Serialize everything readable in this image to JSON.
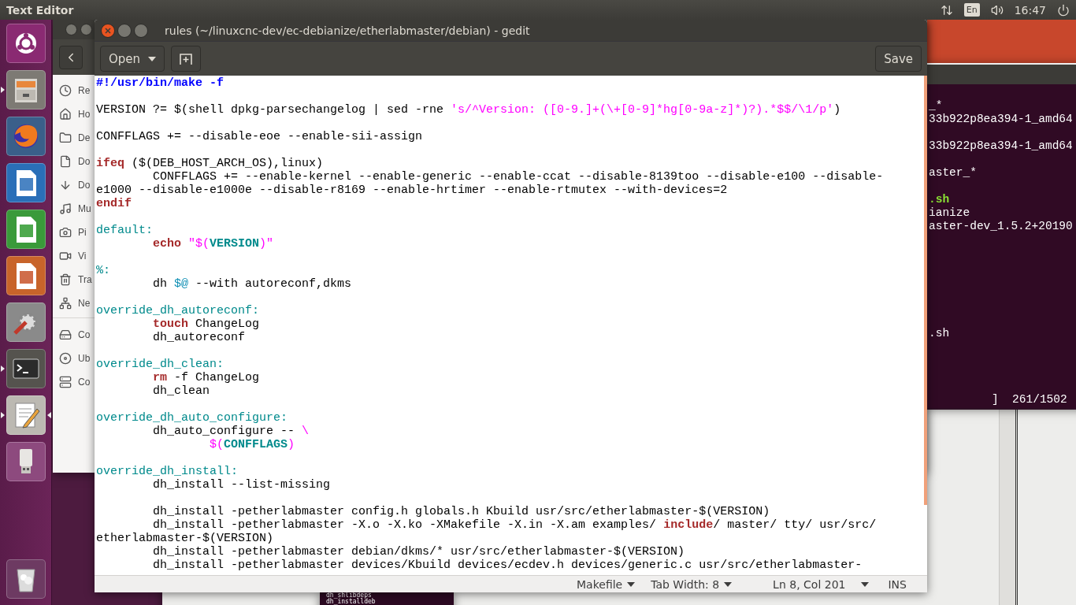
{
  "top_bar": {
    "app_name": "Text Editor",
    "keyboard_layout": "En",
    "clock": "16:47"
  },
  "launcher": {
    "items": [
      {
        "kind": "ubuntu",
        "running": false,
        "focused": false
      },
      {
        "kind": "files",
        "running": true,
        "focused": false
      },
      {
        "kind": "firefox",
        "running": false,
        "focused": false
      },
      {
        "kind": "writer",
        "running": false,
        "focused": false
      },
      {
        "kind": "calc",
        "running": false,
        "focused": false
      },
      {
        "kind": "impress",
        "running": false,
        "focused": false
      },
      {
        "kind": "settings",
        "running": false,
        "focused": false
      },
      {
        "kind": "terminal",
        "running": true,
        "focused": false
      },
      {
        "kind": "text-editor",
        "running": true,
        "focused": true
      },
      {
        "kind": "usb",
        "running": false,
        "focused": false
      },
      {
        "kind": "trash",
        "running": false,
        "focused": false
      }
    ]
  },
  "file_manager": {
    "places": [
      {
        "kind": "recent",
        "label": "Re"
      },
      {
        "kind": "home",
        "label": "Ho"
      },
      {
        "kind": "desktop",
        "label": "De"
      },
      {
        "kind": "documents",
        "label": "Do"
      },
      {
        "kind": "downloads",
        "label": "Do"
      },
      {
        "kind": "music",
        "label": "Mu"
      },
      {
        "kind": "pictures",
        "label": "Pi"
      },
      {
        "kind": "videos",
        "label": "Vi"
      },
      {
        "kind": "trash",
        "label": "Tra"
      },
      {
        "kind": "network",
        "label": "Ne"
      }
    ],
    "devices": [
      {
        "kind": "computer",
        "label": "Co"
      },
      {
        "kind": "drive",
        "label": "Ub"
      },
      {
        "kind": "server",
        "label": "Co"
      }
    ]
  },
  "terminal": {
    "lines": [
      {
        "kind": "text",
        "text": "_*"
      },
      {
        "kind": "text",
        "text": "33b922p8ea394-1_amd64"
      },
      {
        "kind": "blank"
      },
      {
        "kind": "text",
        "text": "33b922p8ea394-1_amd64"
      },
      {
        "kind": "blank"
      },
      {
        "kind": "text",
        "text": "aster_*"
      },
      {
        "kind": "blank"
      },
      {
        "kind": "executable",
        "text": ".sh"
      },
      {
        "kind": "text",
        "text": "ianize"
      },
      {
        "kind": "text",
        "text": "aster-dev_1.5.2+20190"
      },
      {
        "kind": "blank"
      },
      {
        "kind": "blank"
      },
      {
        "kind": "blank"
      },
      {
        "kind": "blank"
      },
      {
        "kind": "blank"
      },
      {
        "kind": "blank"
      },
      {
        "kind": "blank"
      },
      {
        "kind": "text",
        "text": ".sh"
      }
    ],
    "progress": "]  261/1502"
  },
  "bottom_terminal": {
    "lines": [
      "dh_shlibdeps",
      "dh_installdeb"
    ]
  },
  "editor": {
    "title": "rules (~/linuxcnc-dev/ec-debianize/etherlabmaster/debian) - gedit",
    "open_button": "Open",
    "save_button": "Save",
    "lines": [
      {
        "kind": "code",
        "segments": [
          {
            "text": "#!/usr/bin/make -f",
            "kind": "shebang"
          }
        ]
      },
      {
        "kind": "blank"
      },
      {
        "kind": "code",
        "segments": [
          {
            "text": "VERSION ?= $(shell dpkg-parsechangelog | sed -rne ",
            "kind": "plain"
          },
          {
            "text": "'s/^Version: ([0-9.]+(\\+[0-9]*hg[0-9a-z]*)?).*$$/\\1/p'",
            "kind": "string"
          },
          {
            "text": ")",
            "kind": "plain"
          }
        ]
      },
      {
        "kind": "blank"
      },
      {
        "kind": "code",
        "segments": [
          {
            "text": "CONFFLAGS += --disable-eoe --enable-sii-assign",
            "kind": "plain"
          }
        ]
      },
      {
        "kind": "blank"
      },
      {
        "kind": "code",
        "segments": [
          {
            "text": "ifeq",
            "kind": "keyword"
          },
          {
            "text": " ($(DEB_HOST_ARCH_OS),linux)",
            "kind": "plain"
          }
        ]
      },
      {
        "kind": "code",
        "segments": [
          {
            "text": "\tCONFFLAGS += --enable-kernel --enable-generic --enable-ccat --disable-8139too --disable-e100 --disable-",
            "kind": "plain"
          }
        ]
      },
      {
        "kind": "code",
        "segments": [
          {
            "text": "e1000 --disable-e1000e --disable-r8169 --enable-hrtimer --enable-rtmutex --with-devices=2",
            "kind": "plain"
          }
        ]
      },
      {
        "kind": "code",
        "segments": [
          {
            "text": "endif",
            "kind": "keyword"
          }
        ]
      },
      {
        "kind": "blank"
      },
      {
        "kind": "code",
        "segments": [
          {
            "text": "default:",
            "kind": "target"
          }
        ]
      },
      {
        "kind": "code",
        "segments": [
          {
            "text": "\techo",
            "kind": "keyword"
          },
          {
            "text": " \"$(",
            "kind": "string"
          },
          {
            "text": "VERSION",
            "kind": "variable"
          },
          {
            "text": ")\"",
            "kind": "string"
          }
        ]
      },
      {
        "kind": "blank"
      },
      {
        "kind": "code",
        "segments": [
          {
            "text": "%:",
            "kind": "target"
          }
        ]
      },
      {
        "kind": "code",
        "segments": [
          {
            "text": "\tdh ",
            "kind": "plain"
          },
          {
            "text": "$@",
            "kind": "automatic"
          },
          {
            "text": " --with autoreconf,dkms",
            "kind": "plain"
          }
        ]
      },
      {
        "kind": "blank"
      },
      {
        "kind": "code",
        "segments": [
          {
            "text": "override_dh_autoreconf:",
            "kind": "target"
          }
        ]
      },
      {
        "kind": "code",
        "segments": [
          {
            "text": "\ttouch",
            "kind": "keyword"
          },
          {
            "text": " ChangeLog",
            "kind": "plain"
          }
        ]
      },
      {
        "kind": "code",
        "segments": [
          {
            "text": "\tdh_autoreconf",
            "kind": "plain"
          }
        ]
      },
      {
        "kind": "blank"
      },
      {
        "kind": "code",
        "segments": [
          {
            "text": "override_dh_clean:",
            "kind": "target"
          }
        ]
      },
      {
        "kind": "code",
        "segments": [
          {
            "text": "\trm",
            "kind": "keyword"
          },
          {
            "text": " -f ChangeLog",
            "kind": "plain"
          }
        ]
      },
      {
        "kind": "code",
        "segments": [
          {
            "text": "\tdh_clean",
            "kind": "plain"
          }
        ]
      },
      {
        "kind": "blank"
      },
      {
        "kind": "code",
        "segments": [
          {
            "text": "override_dh_auto_configure:",
            "kind": "target"
          }
        ]
      },
      {
        "kind": "code",
        "segments": [
          {
            "text": "\tdh_auto_configure -- ",
            "kind": "plain"
          },
          {
            "text": "\\",
            "kind": "string"
          }
        ]
      },
      {
        "kind": "code",
        "segments": [
          {
            "text": "\t\t$(",
            "kind": "string"
          },
          {
            "text": "CONFFLAGS",
            "kind": "variable"
          },
          {
            "text": ")",
            "kind": "string"
          }
        ]
      },
      {
        "kind": "blank"
      },
      {
        "kind": "code",
        "segments": [
          {
            "text": "override_dh_install:",
            "kind": "target"
          }
        ]
      },
      {
        "kind": "code",
        "segments": [
          {
            "text": "\tdh_install --list-missing",
            "kind": "plain"
          }
        ]
      },
      {
        "kind": "blank"
      },
      {
        "kind": "code",
        "segments": [
          {
            "text": "\tdh_install -petherlabmaster config.h globals.h Kbuild usr/src/etherlabmaster-$(VERSION)",
            "kind": "plain"
          }
        ]
      },
      {
        "kind": "code",
        "segments": [
          {
            "text": "\tdh_install -petherlabmaster -X.o -X.ko -XMakefile -X.in -X.am examples/ ",
            "kind": "plain"
          },
          {
            "text": "include",
            "kind": "keyword"
          },
          {
            "text": "/ master/ tty/ usr/src/",
            "kind": "plain"
          }
        ]
      },
      {
        "kind": "code",
        "segments": [
          {
            "text": "etherlabmaster-$(VERSION)",
            "kind": "plain"
          }
        ]
      },
      {
        "kind": "code",
        "segments": [
          {
            "text": "\tdh_install -petherlabmaster debian/dkms/* usr/src/etherlabmaster-$(VERSION)",
            "kind": "plain"
          }
        ]
      },
      {
        "kind": "code",
        "segments": [
          {
            "text": "\tdh_install -petherlabmaster devices/Kbuild devices/ecdev.h devices/generic.c usr/src/etherlabmaster-",
            "kind": "plain"
          }
        ]
      }
    ],
    "status_bar": {
      "language": "Makefile",
      "tab_width": "Tab Width: 8",
      "position": "Ln 8, Col 201",
      "mode": "INS"
    }
  }
}
